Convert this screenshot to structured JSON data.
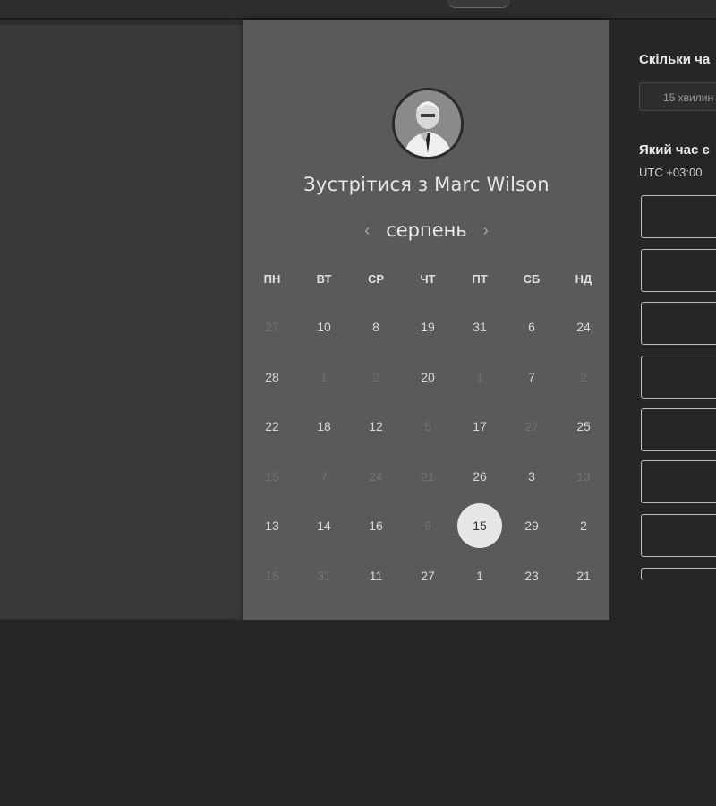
{
  "calendar": {
    "title": "Зустрітися з Marc Wilson",
    "month": "серпень",
    "prev_icon": "‹",
    "next_icon": "›",
    "weekdays": [
      "ПН",
      "ВТ",
      "СР",
      "ЧТ",
      "ПТ",
      "СБ",
      "НД"
    ],
    "weeks": [
      [
        {
          "d": "27",
          "m": true
        },
        {
          "d": "10",
          "m": false
        },
        {
          "d": "8",
          "m": false
        },
        {
          "d": "19",
          "m": false
        },
        {
          "d": "31",
          "m": false
        },
        {
          "d": "6",
          "m": false
        },
        {
          "d": "24",
          "m": false
        }
      ],
      [
        {
          "d": "28",
          "m": false
        },
        {
          "d": "1",
          "m": true
        },
        {
          "d": "2",
          "m": true
        },
        {
          "d": "20",
          "m": false
        },
        {
          "d": "1",
          "m": true
        },
        {
          "d": "7",
          "m": false
        },
        {
          "d": "2",
          "m": true
        }
      ],
      [
        {
          "d": "22",
          "m": false
        },
        {
          "d": "18",
          "m": false
        },
        {
          "d": "12",
          "m": false
        },
        {
          "d": "5",
          "m": true
        },
        {
          "d": "17",
          "m": false
        },
        {
          "d": "27",
          "m": true
        },
        {
          "d": "25",
          "m": false
        }
      ],
      [
        {
          "d": "15",
          "m": true
        },
        {
          "d": "7",
          "m": true
        },
        {
          "d": "24",
          "m": true
        },
        {
          "d": "21",
          "m": true
        },
        {
          "d": "26",
          "m": false
        },
        {
          "d": "3",
          "m": false
        },
        {
          "d": "13",
          "m": true
        }
      ],
      [
        {
          "d": "13",
          "m": false
        },
        {
          "d": "14",
          "m": false
        },
        {
          "d": "16",
          "m": false
        },
        {
          "d": "9",
          "m": true
        },
        {
          "d": "15",
          "m": false,
          "selected": true
        },
        {
          "d": "29",
          "m": false
        },
        {
          "d": "2",
          "m": false
        }
      ],
      [
        {
          "d": "15",
          "m": true
        },
        {
          "d": "31",
          "m": true
        },
        {
          "d": "11",
          "m": false
        },
        {
          "d": "27",
          "m": false
        },
        {
          "d": "1",
          "m": false
        },
        {
          "d": "23",
          "m": false
        },
        {
          "d": "21",
          "m": false
        }
      ]
    ]
  },
  "booking": {
    "duration_question": "Скільки ча",
    "duration_value": "15 хвилин",
    "time_question": "Який час є",
    "timezone": "UTC +03:00"
  },
  "colors": {
    "panel": "#5a5a5a",
    "selected_day": "#e6e6e6"
  }
}
